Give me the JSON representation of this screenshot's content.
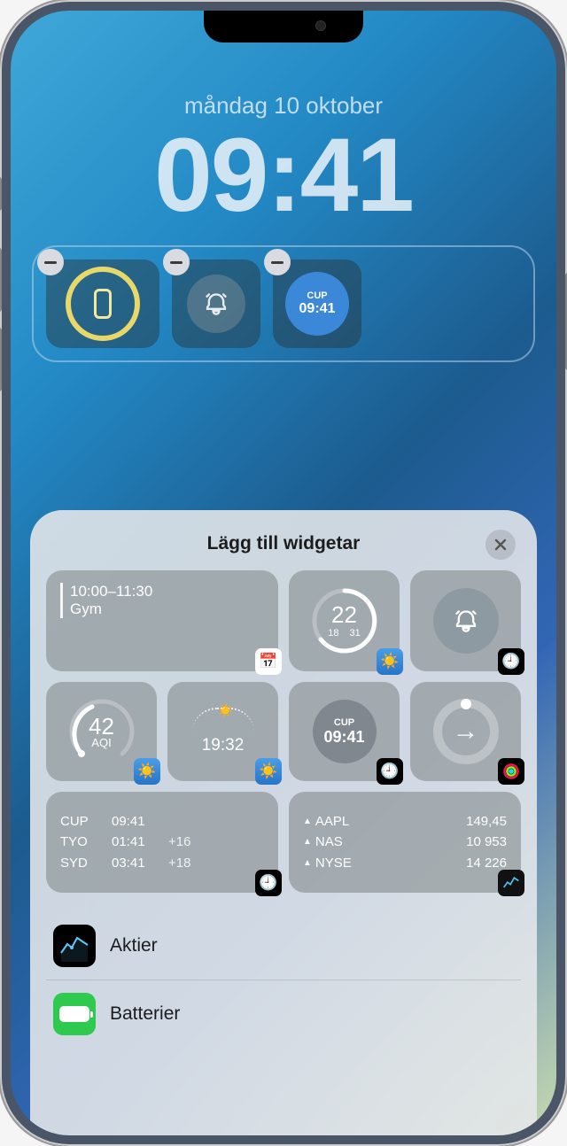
{
  "lock": {
    "date": "måndag 10 oktober",
    "time": "09:41",
    "widgets": {
      "world_clock": {
        "label": "CUP",
        "time": "09:41"
      }
    }
  },
  "sheet": {
    "title": "Lägg till widgetar",
    "suggestions": {
      "calendar": {
        "time": "10:00–11:30",
        "title": "Gym"
      },
      "weather_temp": {
        "value": "22",
        "low": "18",
        "high": "31"
      },
      "aqi": {
        "value": "42",
        "label": "AQI"
      },
      "sunset": {
        "time": "19:32"
      },
      "world_clock_small": {
        "label": "CUP",
        "time": "09:41"
      },
      "world_clock_list": [
        {
          "city": "CUP",
          "time": "09:41",
          "offset": ""
        },
        {
          "city": "TYO",
          "time": "01:41",
          "offset": "+16"
        },
        {
          "city": "SYD",
          "time": "03:41",
          "offset": "+18"
        }
      ],
      "stocks": [
        {
          "symbol": "AAPL",
          "value": "149,45"
        },
        {
          "symbol": "NAS",
          "value": "10 953"
        },
        {
          "symbol": "NYSE",
          "value": "14 226"
        }
      ]
    },
    "apps": [
      {
        "name": "Aktier"
      },
      {
        "name": "Batterier"
      }
    ]
  }
}
